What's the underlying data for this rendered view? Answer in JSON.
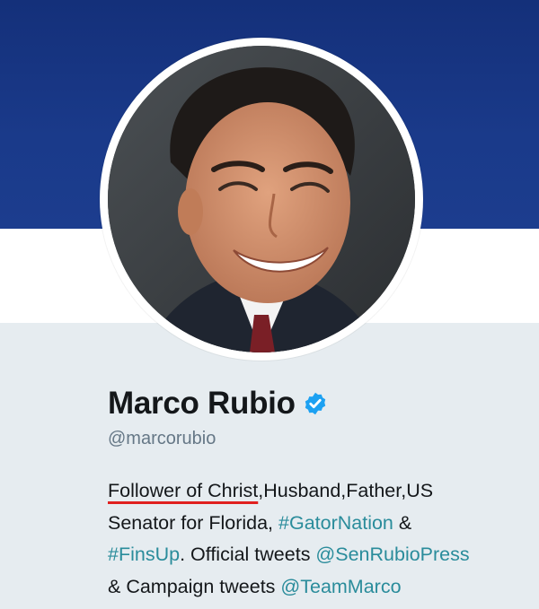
{
  "profile": {
    "name": "Marco Rubio",
    "handle": "@marcorubio",
    "verified": true,
    "avatar_icon": "profile-photo",
    "verified_icon": "verified-badge-icon"
  },
  "bio": {
    "line1_highlight": "Follower of Christ",
    "line1_rest": ",Husband,Father,US",
    "line2_text": "Senator for Florida, ",
    "hashtag1": "#GatorNation",
    "line2_end": " &",
    "hashtag2": "#FinsUp",
    "line3_mid": ". Official tweets ",
    "mention1": "@SenRubioPress",
    "line4_start": "& Campaign tweets ",
    "mention2": "@TeamMarco"
  },
  "colors": {
    "banner": "#1a3a8a",
    "link": "#2a8c9b",
    "underline": "#e0201f",
    "verified": "#1da1f2",
    "background": "#e6ecf0"
  }
}
